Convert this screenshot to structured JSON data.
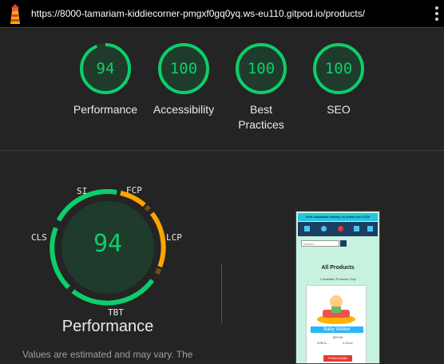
{
  "header": {
    "url": "https://8000-tamariam-kiddiecorner-pmgxf0gq0yq.ws-eu110.gitpod.io/products/",
    "logo_icon": "lighthouse-icon",
    "menu_icon": "more-vert-icon"
  },
  "colors": {
    "pass": "#0cce6b",
    "average": "#ffa400",
    "bg": "#242424"
  },
  "categories": [
    {
      "label": "Performance",
      "score": "94",
      "fraction": 0.94
    },
    {
      "label": "Accessibility",
      "score": "100",
      "fraction": 1.0
    },
    {
      "label": "Best Practices",
      "score": "100",
      "fraction": 1.0
    },
    {
      "label": "SEO",
      "score": "100",
      "fraction": 1.0
    }
  ],
  "performance": {
    "score": "94",
    "title": "Performance",
    "metrics": [
      "SI",
      "FCP",
      "LCP",
      "TBT",
      "CLS"
    ],
    "note": "Values are estimated and may vary. The"
  },
  "preview": {
    "banner": "Free nationwide delivery on orders over £150",
    "search_placeholder": "Search",
    "page_title": "All Products",
    "subtitle": "1 Available Products Only",
    "product_name": "Baby Walker",
    "price": "£29.00",
    "category": "GYM & ...",
    "stock": "In Stock",
    "button": "Product Details"
  }
}
